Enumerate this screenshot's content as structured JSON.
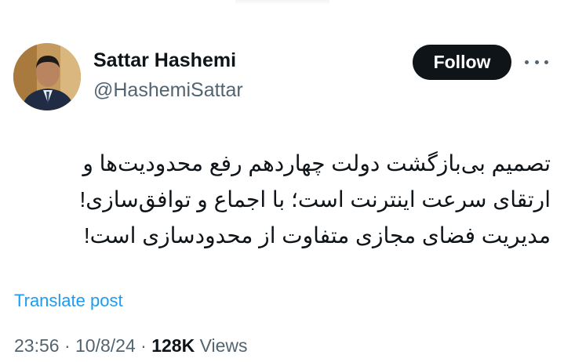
{
  "profile": {
    "display_name": "Sattar Hashemi",
    "handle": "@HashemiSattar",
    "avatar_icon": "user-photo"
  },
  "follow": {
    "label": "Follow"
  },
  "more": {
    "icon": "more-horizontal-icon"
  },
  "tweet": {
    "lines": [
      "تصمیم بی‌بازگشت دولت چهاردهم رفع محدودیت‌ها و",
      "ارتقای سرعت اینترنت است؛ با اجماع و توافق‌سازی!",
      "مدیریت فضای مجازی متفاوت از محدودسازی است!"
    ]
  },
  "translate": {
    "label": "Translate post"
  },
  "meta": {
    "time": "23:56",
    "date": "10/8/24",
    "separator": "·",
    "views_count": "128K",
    "views_label": "Views"
  },
  "colors": {
    "text": "#0f1419",
    "secondary": "#536471",
    "link": "#1d9bf0",
    "button_bg": "#0f1419"
  }
}
